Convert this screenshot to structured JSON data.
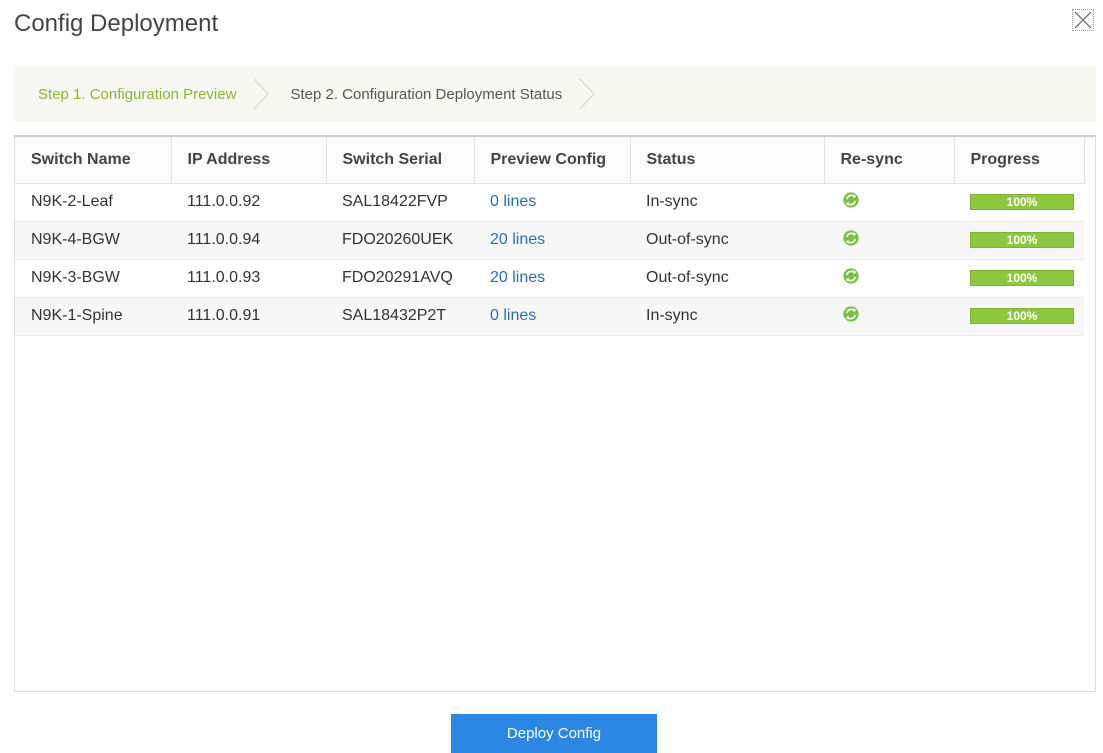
{
  "dialog": {
    "title": "Config Deployment"
  },
  "wizard": {
    "steps": [
      {
        "label": "Step 1. Configuration Preview",
        "active": true
      },
      {
        "label": "Step 2. Configuration Deployment Status",
        "active": false
      }
    ]
  },
  "table": {
    "columns": [
      "Switch Name",
      "IP Address",
      "Switch Serial",
      "Preview Config",
      "Status",
      "Re-sync",
      "Progress"
    ],
    "rows": [
      {
        "switch_name": "N9K-2-Leaf",
        "ip": "111.0.0.92",
        "serial": "SAL18422FVP",
        "preview": "0 lines",
        "status": "In-sync",
        "progress_label": "100%",
        "progress": 100
      },
      {
        "switch_name": "N9K-4-BGW",
        "ip": "111.0.0.94",
        "serial": "FDO20260UEK",
        "preview": "20 lines",
        "status": "Out-of-sync",
        "progress_label": "100%",
        "progress": 100
      },
      {
        "switch_name": "N9K-3-BGW",
        "ip": "111.0.0.93",
        "serial": "FDO20291AVQ",
        "preview": "20 lines",
        "status": "Out-of-sync",
        "progress_label": "100%",
        "progress": 100
      },
      {
        "switch_name": "N9K-1-Spine",
        "ip": "111.0.0.91",
        "serial": "SAL18432P2T",
        "preview": "0 lines",
        "status": "In-sync",
        "progress_label": "100%",
        "progress": 100
      }
    ]
  },
  "footer": {
    "deploy_label": "Deploy Config"
  },
  "icons": {
    "close": "close-icon",
    "resync": "resync-icon",
    "step_separator": "chevron-right-icon"
  },
  "colors": {
    "active_step": "#8cb534",
    "link": "#2a6ebb",
    "progress": "#8dc63f",
    "primary_button": "#2b87e3"
  }
}
